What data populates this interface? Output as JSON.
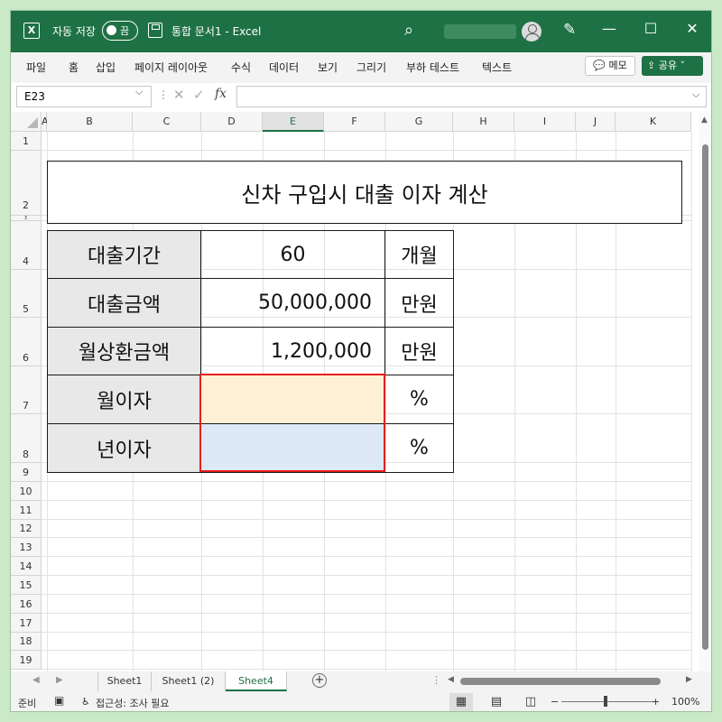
{
  "titlebar": {
    "logo": "X",
    "autosave_label": "자동 저장",
    "autosave_state": "끔",
    "doc_title": "통합 문서1  -  Excel",
    "search_icon": "⌕",
    "pen_icon": "✎",
    "minimize": "—",
    "restore": "☐",
    "close": "✕"
  },
  "menu": {
    "items": [
      "파일",
      "홈",
      "삽입",
      "페이지 레이아웃",
      "수식",
      "데이터",
      "보기",
      "그리기",
      "부하 테스트",
      "텍스트"
    ],
    "memo_label": "메모",
    "memo_icon": "💬",
    "share_label": "공유",
    "share_icon": "⇪",
    "share_caret": "˅"
  },
  "formula_bar": {
    "name_box": "E23",
    "name_caret": "⌵",
    "dots": "⋮",
    "cancel": "✕",
    "enter": "✓",
    "fx": "fx",
    "value": "",
    "expand": "⌵"
  },
  "grid": {
    "columns": [
      "A",
      "B",
      "C",
      "D",
      "E",
      "F",
      "G",
      "H",
      "I",
      "J",
      "K"
    ],
    "selected_column": "E",
    "rows": [
      "1",
      "2",
      "3",
      "4",
      "5",
      "6",
      "7",
      "8",
      "9",
      "10",
      "11",
      "12",
      "13",
      "14",
      "15",
      "16",
      "17",
      "18",
      "19"
    ]
  },
  "table": {
    "title": "신차 구입시 대출 이자 계산",
    "rows": [
      {
        "label": "대출기간",
        "value": "60",
        "unit": "개월"
      },
      {
        "label": "대출금액",
        "value": "50,000,000",
        "unit": "만원"
      },
      {
        "label": "월상환금액",
        "value": "1,200,000",
        "unit": "만원"
      },
      {
        "label": "월이자",
        "value": "",
        "unit": "%"
      },
      {
        "label": "년이자",
        "value": "",
        "unit": "%"
      }
    ]
  },
  "sheets": {
    "tabs": [
      "Sheet1",
      "Sheet1 (2)",
      "Sheet4"
    ],
    "active": "Sheet4",
    "add": "+"
  },
  "status": {
    "ready": "준비",
    "accessibility": "접근성: 조사 필요",
    "zoom_minus": "−",
    "zoom_plus": "+",
    "zoom": "100%"
  },
  "colors": {
    "excel_green": "#1e7145",
    "label_fill": "#e8e8e8",
    "peach_fill": "#fdf0d5",
    "blue_fill": "#ddeaf5",
    "highlight_border": "#e81d1d"
  }
}
